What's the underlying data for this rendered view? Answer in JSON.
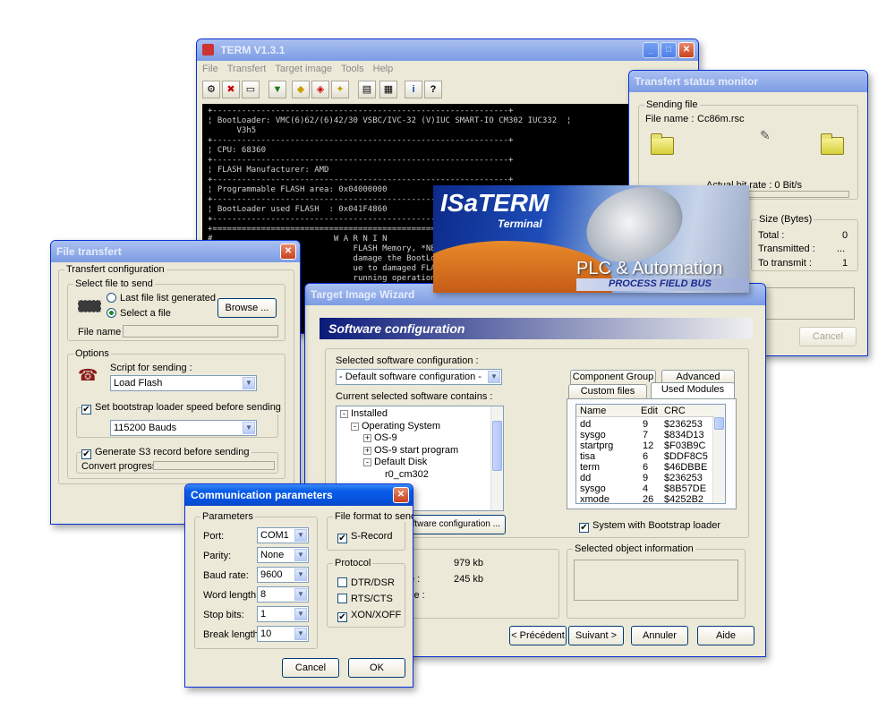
{
  "main": {
    "title": "TERM V1.3.1",
    "menu": [
      "File",
      "Transfert",
      "Target image",
      "Tools",
      "Help"
    ],
    "console_lines": [
      "+-------------------------------------------------------------+",
      "¦ BootLoader: VMC(6)62/(6)42/30 VSBC/IVC-32 (V)IUC SMART-IO CM302 IUC332  ¦",
      "      V3h5",
      "+-------------------------------------------------------------+",
      "¦ CPU: 68360",
      "+-------------------------------------------------------------+",
      "¦ FLASH Manufacturer: AMD",
      "+-------------------------------------------------------------+",
      "¦ Programmable FLASH area: 0x04000000",
      "+-------------------------------------------------------------+",
      "¦ BootLoader used FLASH  : 0x041F4860",
      "+-------------------------------------------------------------+",
      "+=============================================================+",
      "#                         W A R N I N",
      "                              FLASH Memory, *NEVER* p",
      "                              damage the BootLoader and",
      "                              ue to damaged FLASH conte",
      "                              running operation."
    ]
  },
  "monitor": {
    "title": "Transfert status monitor",
    "sending_group": "Sending file",
    "file_name_label": "File name :",
    "file_name": "Cc86m.rsc",
    "bitrate": "Actual bit rate : 0 Bit/s",
    "size_group": "Size (Bytes)",
    "total_label": "Total :",
    "total": "0",
    "transmitted_label": "Transmitted :",
    "transmitted": "...",
    "to_transmit_label": "To transmit :",
    "to_transmit": "1",
    "cancel": "Cancel"
  },
  "splash": {
    "brand": "ISaTERM",
    "sub": "Terminal",
    "tagline": "PLC & Automation",
    "bus": "PROCESS FIELD BUS"
  },
  "file_transfer": {
    "title": "File transfert",
    "config_group": "Transfert configuration",
    "select_group": "Select file to send",
    "radio_last": "Last file list generated",
    "radio_select": "Select a file",
    "browse": "Browse ...",
    "file_name_label": "File name :",
    "options_group": "Options",
    "script_label": "Script for sending :",
    "script_value": "Load Flash",
    "bootstrap_check": "Set bootstrap loader speed before sending",
    "baud_value": "115200 Bauds",
    "s3_check": "Generate S3 record before sending",
    "convert_label": "Convert progress :"
  },
  "wizard": {
    "title": "Target Image Wizard",
    "header": "Software configuration",
    "selected_label": "Selected software configuration :",
    "selected_value": "- Default software configuration -",
    "contains_label": "Current selected software contains :",
    "tree": [
      {
        "label": "Installed",
        "sym": "-"
      },
      {
        "label": "Operating System",
        "sym": "-"
      },
      {
        "label": "OS-9",
        "sym": "+"
      },
      {
        "label": "OS-9 start program",
        "sym": "+"
      },
      {
        "label": "Default Disk",
        "sym": "-"
      },
      {
        "label": "r0_cm302",
        "sym": ""
      }
    ],
    "config_btn": "oftware configuration ...",
    "tabs": [
      "Component Group",
      "Advanced",
      "Custom files",
      "Used Modules"
    ],
    "cols": [
      "Name",
      "Edit",
      "CRC"
    ],
    "modules": [
      {
        "name": "dd",
        "edit": "9",
        "crc": "$236253"
      },
      {
        "name": "sysgo",
        "edit": "7",
        "crc": "$834D13"
      },
      {
        "name": "startprg",
        "edit": "12",
        "crc": "$F03B9C"
      },
      {
        "name": "tisa",
        "edit": "6",
        "crc": "$DDF8C5"
      },
      {
        "name": "term",
        "edit": "6",
        "crc": "$46DBBE"
      },
      {
        "name": "dd",
        "edit": "9",
        "crc": "$236253"
      },
      {
        "name": "sysgo",
        "edit": "4",
        "crc": "$8B57DE"
      },
      {
        "name": "xmode",
        "edit": "26",
        "crc": "$4252B2"
      }
    ],
    "bootstrap_check": "System with Bootstrap loader",
    "info_group_left": "on",
    "size_rows": [
      {
        "label": "e :",
        "value": "979 kb"
      },
      {
        "label": "ize :",
        "value": "245 kb"
      },
      {
        "label": "size :",
        "value": ""
      }
    ],
    "selected_info_group": "Selected object information",
    "prev": "< Précédent",
    "next": "Suivant >",
    "cancel": "Annuler",
    "help": "Aide"
  },
  "comm": {
    "title": "Communication parameters",
    "params_group": "Parameters",
    "params": [
      {
        "label": "Port:",
        "value": "COM1"
      },
      {
        "label": "Parity:",
        "value": "None"
      },
      {
        "label": "Baud rate:",
        "value": "9600"
      },
      {
        "label": "Word length:",
        "value": "8"
      },
      {
        "label": "Stop bits:",
        "value": "1"
      },
      {
        "label": "Break length:",
        "value": "10"
      }
    ],
    "format_group": "File format to send",
    "srecord": "S-Record",
    "protocol_group": "Protocol",
    "protocols": [
      {
        "label": "DTR/DSR",
        "checked": false
      },
      {
        "label": "RTS/CTS",
        "checked": false
      },
      {
        "label": "XON/XOFF",
        "checked": true
      }
    ],
    "cancel": "Cancel",
    "ok": "OK"
  }
}
